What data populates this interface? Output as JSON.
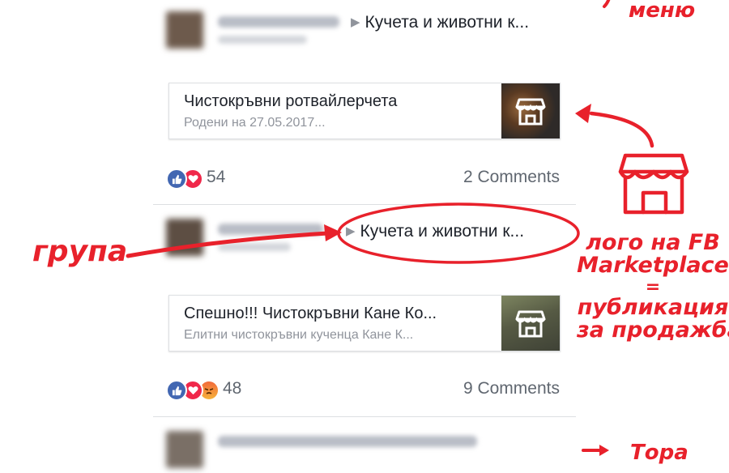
{
  "posts": [
    {
      "group_link": "Кучета и животни к...",
      "listing": {
        "title": "Чистокръвни ротвайлерчета",
        "subtitle": "Родени на 27.05.2017..."
      },
      "reactions": [
        "like",
        "love"
      ],
      "reaction_count": "54",
      "comments": "2 Comments"
    },
    {
      "group_link": "Кучета и животни к...",
      "listing": {
        "title": "Спешно!!! Чистокръвни Кане Ко...",
        "subtitle": "Елитни чистокръвни кученца Кане К..."
      },
      "reactions": [
        "like",
        "love",
        "angry"
      ],
      "reaction_count": "48",
      "comments": "9 Comments"
    }
  ],
  "annotations": {
    "menu": "меню",
    "group": "група",
    "marketplace_line1": "лого на FB",
    "marketplace_line2": "Marketplace",
    "marketplace_line3": "=",
    "marketplace_line4": "публикация",
    "marketplace_line5": "за продажба!",
    "bottom_cut": "Тора"
  },
  "colors": {
    "annotation": "#e8212b",
    "like": "#4267b2",
    "love": "#f0284a",
    "muted_text": "#90949c"
  },
  "icons": [
    "store-icon",
    "like-icon",
    "love-icon",
    "angry-icon",
    "caret-right-icon"
  ]
}
